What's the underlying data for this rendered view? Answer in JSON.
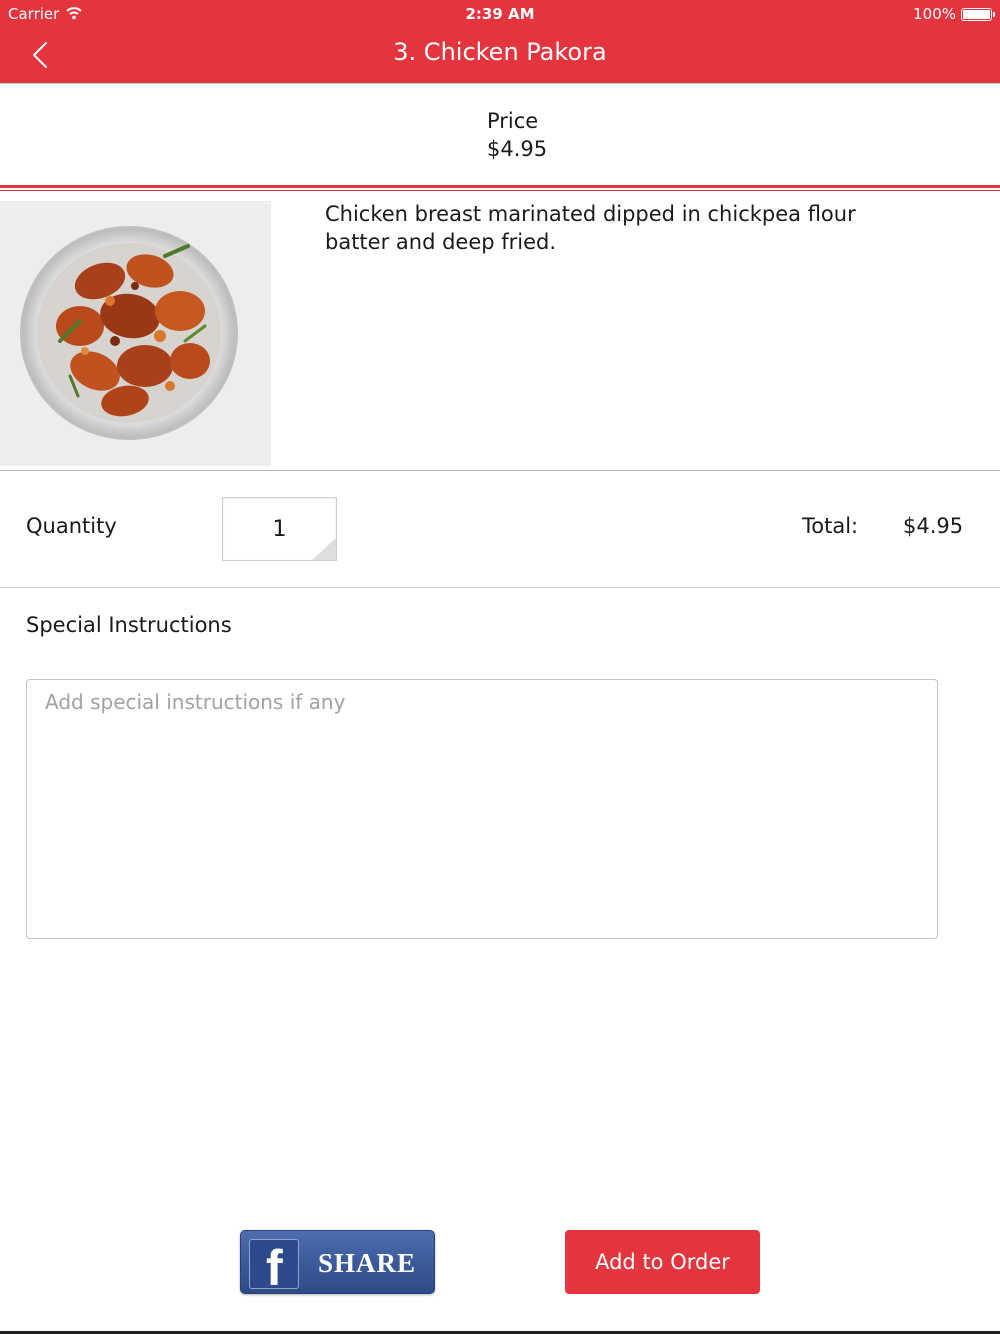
{
  "status_bar": {
    "carrier": "Carrier",
    "time": "2:39 AM",
    "battery": "100%"
  },
  "nav": {
    "title": "3. Chicken Pakora"
  },
  "price": {
    "label": "Price",
    "value": "$4.95"
  },
  "item": {
    "description": "Chicken breast marinated dipped in chickpea flour batter and deep fried."
  },
  "order": {
    "quantity_label": "Quantity",
    "quantity_value": "1",
    "total_label": "Total:",
    "total_value": "$4.95"
  },
  "instructions": {
    "label": "Special Instructions",
    "placeholder": "Add special instructions if any"
  },
  "actions": {
    "share_label": "SHARE",
    "add_label": "Add to Order"
  },
  "colors": {
    "accent": "#e4353f",
    "facebook": "#3b5998"
  }
}
